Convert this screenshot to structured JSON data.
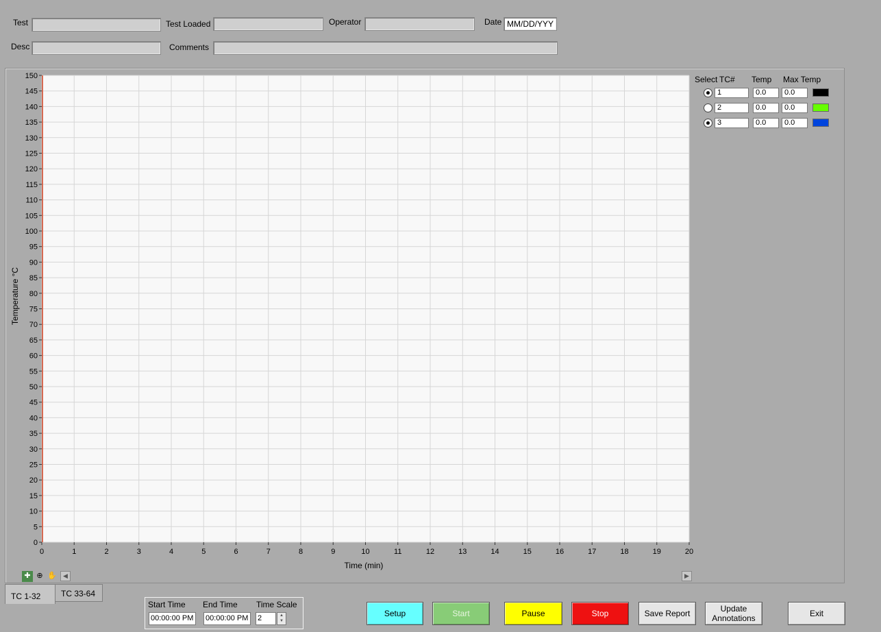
{
  "header": {
    "test_label": "Test",
    "test_value": "",
    "test_loaded_label": "Test Loaded",
    "test_loaded_value": "",
    "operator_label": "Operator",
    "operator_value": "",
    "date_label": "Date",
    "date_value": "MM/DD/YYY",
    "desc_label": "Desc",
    "desc_value": "",
    "comments_label": "Comments",
    "comments_value": ""
  },
  "chart_data": {
    "type": "line",
    "xlabel": "Time (min)",
    "ylabel": "Temperature °C",
    "xlim": [
      0,
      20
    ],
    "ylim": [
      0,
      150
    ],
    "x_ticks": [
      0,
      1,
      2,
      3,
      4,
      5,
      6,
      7,
      8,
      9,
      10,
      11,
      12,
      13,
      14,
      15,
      16,
      17,
      18,
      19,
      20
    ],
    "y_ticks": [
      0,
      5,
      10,
      15,
      20,
      25,
      30,
      35,
      40,
      45,
      50,
      55,
      60,
      65,
      70,
      75,
      80,
      85,
      90,
      95,
      100,
      105,
      110,
      115,
      120,
      125,
      130,
      135,
      140,
      145,
      150
    ],
    "grid": true,
    "cursor": {
      "x": 0,
      "color": "#d04020"
    },
    "series": []
  },
  "legend": {
    "select_header": "Select",
    "tc_header": "TC#",
    "temp_header": "Temp",
    "max_temp_header": "Max Temp",
    "rows": [
      {
        "selected": true,
        "tc": "1",
        "temp": "0.0",
        "max_temp": "0.0",
        "color": "#000000"
      },
      {
        "selected": false,
        "tc": "2",
        "temp": "0.0",
        "max_temp": "0.0",
        "color": "#66ff00"
      },
      {
        "selected": true,
        "tc": "3",
        "temp": "0.0",
        "max_temp": "0.0",
        "color": "#0044dd"
      }
    ]
  },
  "graph_tools": {
    "cursor_icon": "crosshair-icon",
    "zoom_icon": "zoom-icon",
    "pan_icon": "hand-icon"
  },
  "tabs": [
    {
      "label": "TC 1-32",
      "active": true
    },
    {
      "label": "TC 33-64",
      "active": false
    }
  ],
  "time_controls": {
    "start_time_label": "Start Time",
    "start_time_value": "00:00:00 PM",
    "end_time_label": "End Time",
    "end_time_value": "00:00:00 PM",
    "time_scale_label": "Time Scale",
    "time_scale_value": "2"
  },
  "buttons": {
    "setup": {
      "label": "Setup",
      "color": "#66ffff"
    },
    "start": {
      "label": "Start",
      "color": "#88cc77",
      "text_color": "#e8f5e0"
    },
    "pause": {
      "label": "Pause",
      "color": "#ffff00"
    },
    "stop": {
      "label": "Stop",
      "color": "#ee1111",
      "text_color": "#ffffff"
    },
    "save_report": {
      "label": "Save Report",
      "color": "#e6e6e6"
    },
    "update_annotations_line1": "Update",
    "update_annotations_line2": "Annotations",
    "update_annotations_color": "#e6e6e6",
    "exit": {
      "label": "Exit",
      "color": "#e6e6e6"
    }
  }
}
